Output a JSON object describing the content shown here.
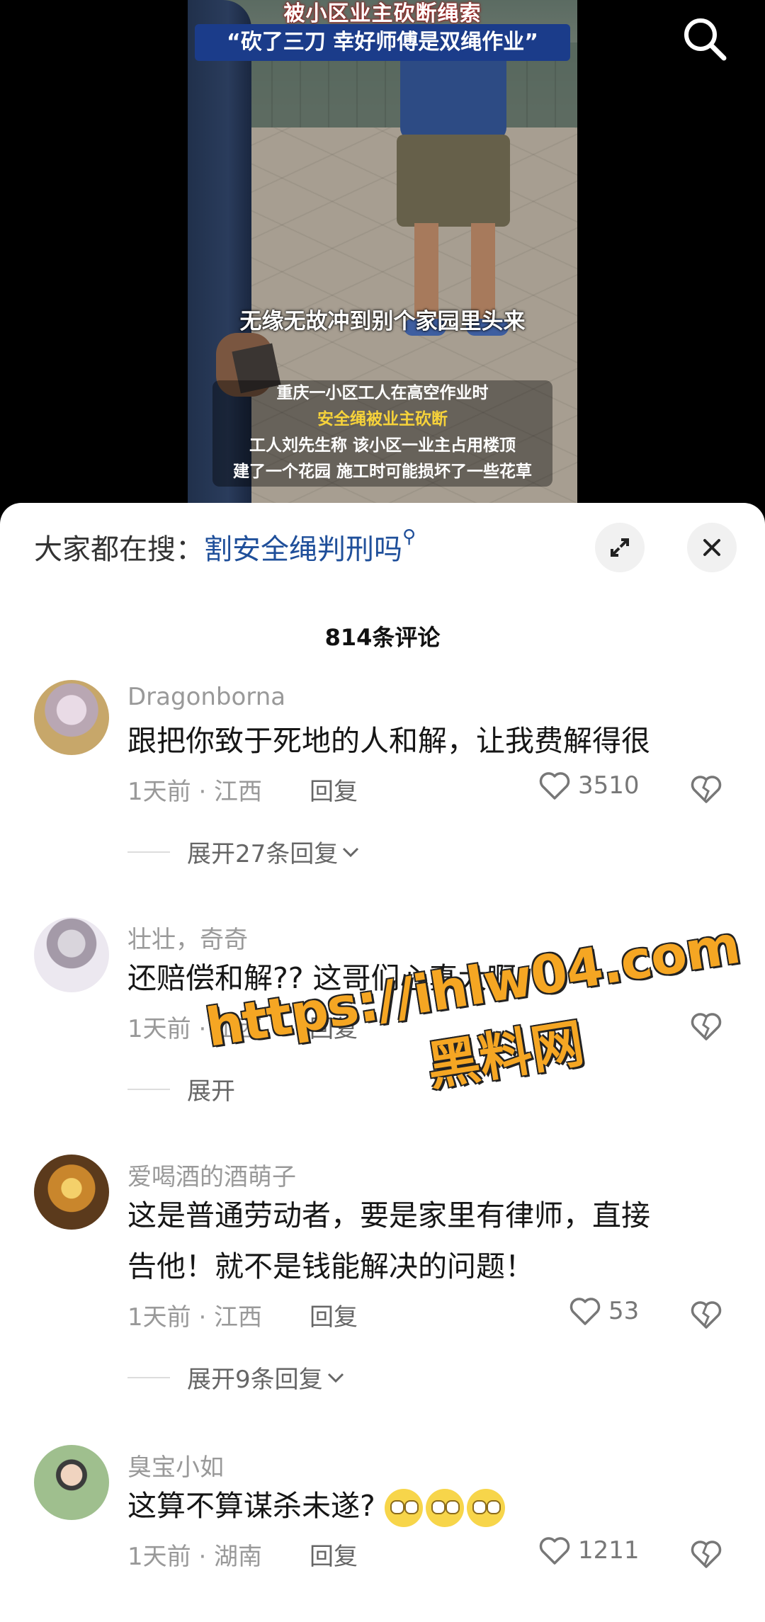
{
  "video": {
    "headline_top": "被小区业主砍断绳索",
    "headline_banner": "“砍了三刀 幸好师傅是双绳作业”",
    "caption_center": "无缘无故冲到别个家园里头来",
    "caption_box_line1": "重庆一小区工人在高空作业时",
    "caption_box_line2": "安全绳被业主砍断",
    "caption_box_line3": "工人刘先生称 该小区一业主占用楼顶",
    "caption_box_line4": "建了一个花园 施工时可能损坏了一些花草",
    "search_icon": "search-icon"
  },
  "sheet": {
    "trending_prefix": "大家都在搜：",
    "trending_query": "割安全绳判刑吗",
    "comment_count": "814条评论",
    "expand_icon": "expand-icon",
    "close_icon": "close-icon"
  },
  "comments": [
    {
      "name": "Dragonborna",
      "text": "跟把你致于死地的人和解，让我费解得很",
      "meta": "1天前 · 江西",
      "reply": "回复",
      "likes": "3510",
      "expand": "展开27条回复"
    },
    {
      "name": "壮壮，奇奇",
      "text": "还赔偿和解??  这哥们心真大啊",
      "meta": "1天前 · 山西",
      "reply": "回复",
      "likes": "",
      "expand": "展开"
    },
    {
      "name": "爱喝酒的酒萌子",
      "text_line1": "这是普通劳动者，要是家里有律师，直接",
      "text_line2": "告他！就不是钱能解决的问题！",
      "meta": "1天前 · 江西",
      "reply": "回复",
      "likes": "53",
      "expand": "展开9条回复"
    },
    {
      "name": "臭宝小如",
      "text": "这算不算谋杀未遂?",
      "meta": "1天前 · 湖南",
      "reply": "回复",
      "likes": "1211"
    }
  ],
  "watermark": {
    "url": "https://ihlw04.com",
    "name": "黑料网"
  },
  "colors": {
    "link_blue": "#1f4f9a",
    "watermark_orange": "#f5a623",
    "banner_blue": "#1b3c8a"
  }
}
